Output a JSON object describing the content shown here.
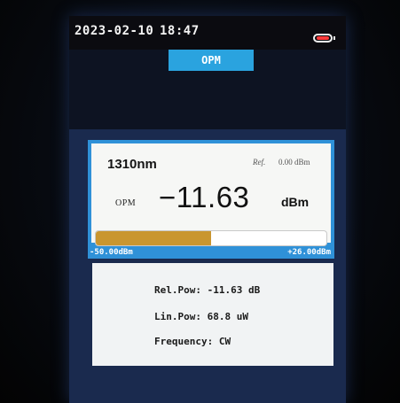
{
  "status_bar": {
    "date": "2023-02-10",
    "time": "18:47",
    "battery_icon": "battery-low-icon",
    "battery_color": "#ff3b3b"
  },
  "mode_tab": {
    "label": "OPM",
    "color": "#2aa3df"
  },
  "measurement": {
    "wavelength": "1310nm",
    "ref_label": "Ref.",
    "ref_value": "0.00 dBm",
    "mode_label": "OPM",
    "power_value": "−11.63",
    "power_unit": "dBm",
    "bar_min_label": "-50.00dBm",
    "bar_max_label": "+26.00dBm",
    "bar_fill_fraction": 0.5,
    "bar_color": "#c99630"
  },
  "info": {
    "rel_pow": "Rel.Pow: -11.63 dB",
    "lin_pow": "Lin.Pow: 68.8 uW",
    "frequency": "Frequency: CW"
  }
}
